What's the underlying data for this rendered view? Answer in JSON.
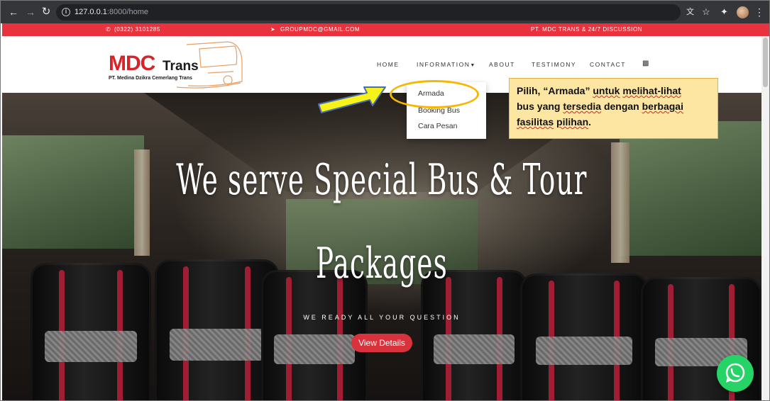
{
  "browser": {
    "url_host": "127.0.0.1",
    "url_path": ":8000/home",
    "back_icon": "arrow-left-icon",
    "forward_icon": "arrow-right-icon",
    "reload_icon": "reload-icon"
  },
  "topbar": {
    "phone": "(0322) 3101285",
    "email": "GROUPMDC@GMAIL.COM",
    "tagline": "PT. MDC TRANS & 24/7 DISCUSSION"
  },
  "logo": {
    "brand": "MDC",
    "brand2": "Trans",
    "subtitle": "PT. Medina Dzikra Cemerlang Trans"
  },
  "menu": {
    "home": "HOME",
    "information": "INFORMATION",
    "about": "ABOUT",
    "testimony": "TESTIMONY",
    "contact": "CONTACT"
  },
  "dropdown": {
    "items": [
      "Armada",
      "Booking Bus",
      "Cara Pesan"
    ]
  },
  "hero": {
    "title_line1": "We serve Special Bus & Tour",
    "title_line2": "Packages",
    "subtitle": "WE READY ALL YOUR QUESTION",
    "button": "View Details"
  },
  "callout": {
    "line1_a": "Pilih, “Armada” ",
    "line1_b": "untuk",
    "line1_c": " ",
    "line1_d": "melihat-lihat",
    "line2_a": "bus yang ",
    "line2_b": "tersedia",
    "line2_c": " dengan ",
    "line2_d": "berbagai",
    "line3_a": "fasilitas",
    "line3_b": " ",
    "line3_c": "pilihan",
    "line3_d": "."
  },
  "colors": {
    "brand_red": "#e8323d",
    "callout_bg": "#fde5a2",
    "annotation_yellow": "#f5b800",
    "whatsapp_green": "#25d366"
  }
}
